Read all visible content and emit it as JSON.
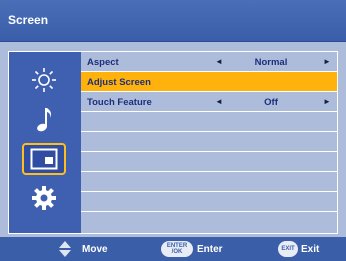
{
  "header": {
    "title": "Screen"
  },
  "sidebar": {
    "items": [
      {
        "icon": "brightness-icon"
      },
      {
        "icon": "music-note-icon"
      },
      {
        "icon": "screen-icon"
      },
      {
        "icon": "gear-icon"
      }
    ],
    "selected_index": 2
  },
  "menu": {
    "rows": [
      {
        "label": "Aspect",
        "value": "Normal"
      },
      {
        "label": "Adjust Screen"
      },
      {
        "label": "Touch Feature",
        "value": "Off"
      }
    ],
    "left_arrow": "◄",
    "right_arrow": "►"
  },
  "footer": {
    "move_label": "Move",
    "enter_key_line1": "ENTER",
    "enter_key_line2": "/OK",
    "enter_label": "Enter",
    "exit_key": "EXIT",
    "exit_label": "Exit"
  },
  "colors": {
    "header_bg": "#3a5ea8",
    "panel_bg": "#3f5fb0",
    "row_bg": "#aebcdc",
    "highlight": "#ffb20b",
    "text": "#1c2f7a"
  }
}
